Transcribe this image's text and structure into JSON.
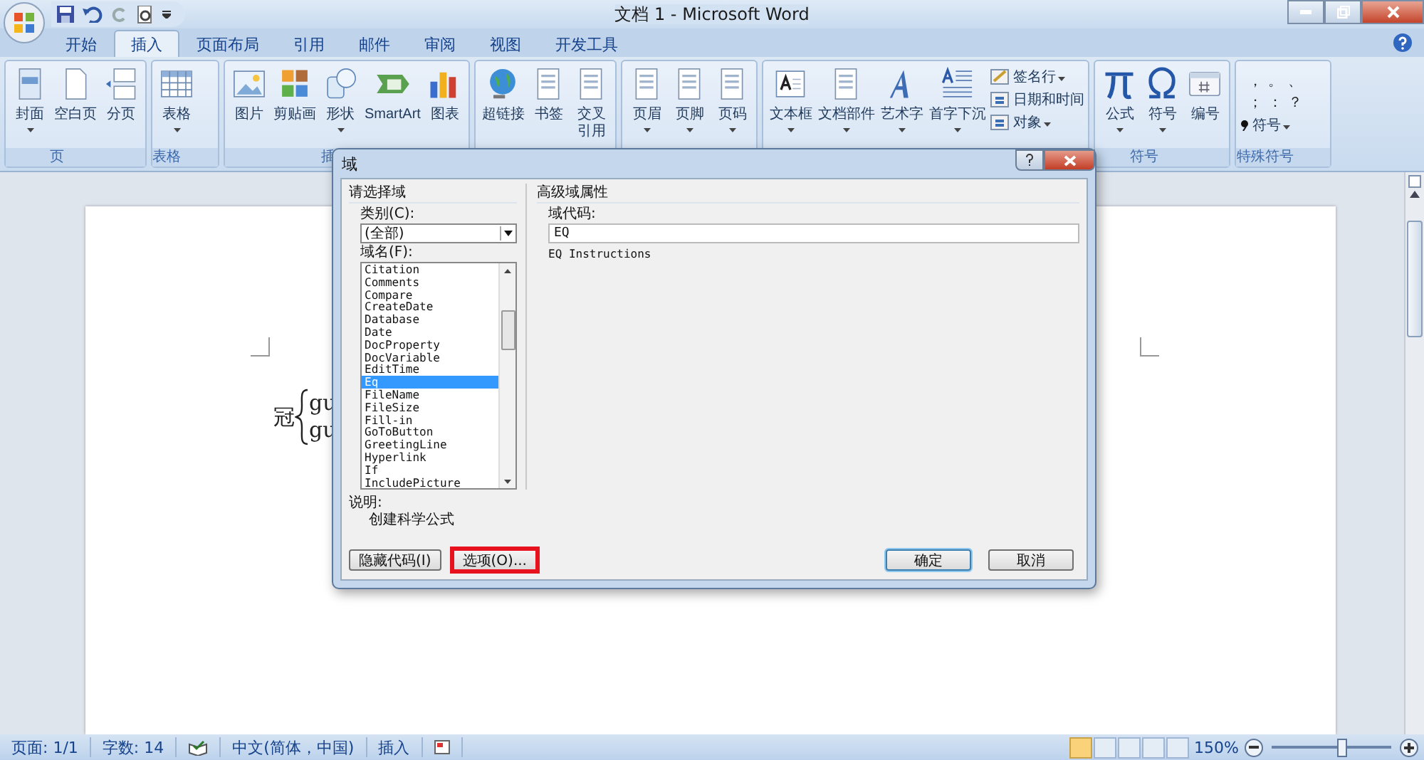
{
  "window": {
    "title": "文档 1 - Microsoft Word"
  },
  "tabs": [
    {
      "label": "开始",
      "selected": false
    },
    {
      "label": "插入",
      "selected": true
    },
    {
      "label": "页面布局",
      "selected": false
    },
    {
      "label": "引用",
      "selected": false
    },
    {
      "label": "邮件",
      "selected": false
    },
    {
      "label": "审阅",
      "selected": false
    },
    {
      "label": "视图",
      "selected": false
    },
    {
      "label": "开发工具",
      "selected": false
    }
  ],
  "ribbon": {
    "groups": [
      {
        "label": "页",
        "items": [
          {
            "label": "封面",
            "has_menu": true
          },
          {
            "label": "空白页",
            "has_menu": false
          },
          {
            "label": "分页",
            "has_menu": false
          }
        ]
      },
      {
        "label": "表格",
        "items": [
          {
            "label": "表格",
            "has_menu": true
          }
        ]
      },
      {
        "label": "插",
        "items": [
          {
            "label": "图片",
            "has_menu": false
          },
          {
            "label": "剪贴画",
            "has_menu": false
          },
          {
            "label": "形状",
            "has_menu": true
          },
          {
            "label": "SmartArt",
            "has_menu": false
          },
          {
            "label": "图表",
            "has_menu": false
          }
        ]
      },
      {
        "items": [
          {
            "label": "超链接",
            "has_menu": false
          },
          {
            "label": "书签",
            "has_menu": false
          },
          {
            "label": [
              "交叉",
              "引用"
            ],
            "has_menu": false
          }
        ]
      },
      {
        "items": [
          {
            "label": "页眉",
            "has_menu": true
          },
          {
            "label": "页脚",
            "has_menu": true
          },
          {
            "label": "页码",
            "has_menu": true
          }
        ]
      },
      {
        "items": [
          {
            "label": "文本框",
            "has_menu": true
          },
          {
            "label": "文档部件",
            "has_menu": true
          },
          {
            "label": "艺术字",
            "has_menu": true
          },
          {
            "label": "首字下沉",
            "has_menu": true
          }
        ],
        "small_items": [
          {
            "label": "签名行",
            "has_menu": true
          },
          {
            "label": "日期和时间",
            "has_menu": false
          },
          {
            "label": "对象",
            "has_menu": true
          }
        ]
      },
      {
        "label": "符号",
        "items": [
          {
            "label": "公式",
            "has_menu": true
          },
          {
            "label": "符号",
            "has_menu": true
          },
          {
            "label": "编号",
            "has_menu": false
          }
        ]
      },
      {
        "label": "特殊符号",
        "symbols": [
          "，",
          "。",
          "、",
          "；",
          "：",
          "？"
        ],
        "menu": {
          "label": "符号",
          "has_menu": true
        }
      }
    ]
  },
  "document": {
    "formula": {
      "base": "冠",
      "top": "gu",
      "bottom": "gu"
    }
  },
  "dialog": {
    "title": "域",
    "left_section": "请选择域",
    "category_label": "类别(C):",
    "category_value": "(全部)",
    "field_names_label": "域名(F):",
    "field_names": [
      {
        "label": "Citation",
        "selected": false
      },
      {
        "label": "Comments",
        "selected": false
      },
      {
        "label": "Compare",
        "selected": false
      },
      {
        "label": "CreateDate",
        "selected": false
      },
      {
        "label": "Database",
        "selected": false
      },
      {
        "label": "Date",
        "selected": false
      },
      {
        "label": "DocProperty",
        "selected": false
      },
      {
        "label": "DocVariable",
        "selected": false
      },
      {
        "label": "EditTime",
        "selected": false
      },
      {
        "label": "Eq",
        "selected": true
      },
      {
        "label": "FileName",
        "selected": false
      },
      {
        "label": "FileSize",
        "selected": false
      },
      {
        "label": "Fill-in",
        "selected": false
      },
      {
        "label": "GoToButton",
        "selected": false
      },
      {
        "label": "GreetingLine",
        "selected": false
      },
      {
        "label": "Hyperlink",
        "selected": false
      },
      {
        "label": "If",
        "selected": false
      },
      {
        "label": "IncludePicture",
        "selected": false
      }
    ],
    "description_label": "说明:",
    "description": "创建科学公式",
    "right_section": "高级域属性",
    "field_code_label": "域代码:",
    "field_code": "EQ",
    "field_code_hint": "EQ Instructions",
    "left_buttons": [
      {
        "label": "隐藏代码(I)",
        "default": false,
        "highlighted": false
      },
      {
        "label": "选项(O)...",
        "default": false,
        "highlighted": true
      }
    ],
    "right_buttons": [
      {
        "label": "确定",
        "default": true,
        "highlighted": false
      },
      {
        "label": "取消",
        "default": false,
        "highlighted": false
      }
    ]
  },
  "status_bar": {
    "page": "页面: 1/1",
    "words": "字数: 14",
    "language": "中文(简体，中国)",
    "mode": "插入",
    "zoom": "150%",
    "zoom_slider": {
      "level": 0.58
    }
  }
}
